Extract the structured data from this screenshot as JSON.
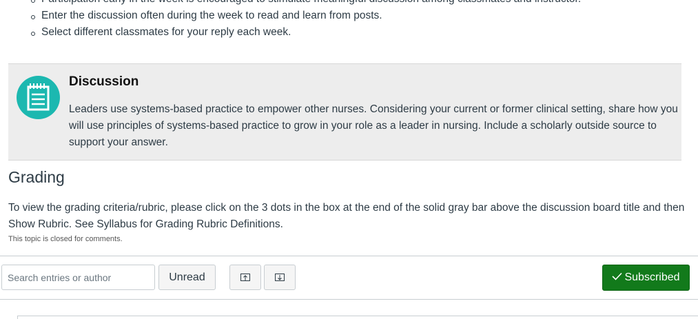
{
  "intro": {
    "bullets": [
      "Participation early in the week is encouraged to stimulate meaningful discussion among classmates and instructor.",
      "Enter the discussion often during the week to read and learn from posts.",
      "Select different classmates for your reply each week."
    ]
  },
  "callout": {
    "icon": "notepad-icon",
    "icon_color": "#1cb8b0",
    "title": "Discussion",
    "body": "Leaders use systems-based practice to empower other nurses. Considering your current or former clinical setting, share how you will use principles of systems-based practice to grow in your role as a leader in nursing. Include a scholarly outside source to support your answer."
  },
  "grading": {
    "heading": "Grading",
    "text": "To view the grading criteria/rubric, please click on the 3 dots in the box at the end of the solid gray bar above the discussion board title and then Show Rubric. See Syllabus for Grading Rubric Definitions.",
    "closed_note": "This topic is closed for comments."
  },
  "toolbar": {
    "search_placeholder": "Search entries or author",
    "unread_label": "Unread",
    "collapse_icon": "arrow-up-icon",
    "expand_icon": "arrow-down-icon",
    "subscribed_label": "Subscribed",
    "subscribed_color": "#127a1b"
  }
}
